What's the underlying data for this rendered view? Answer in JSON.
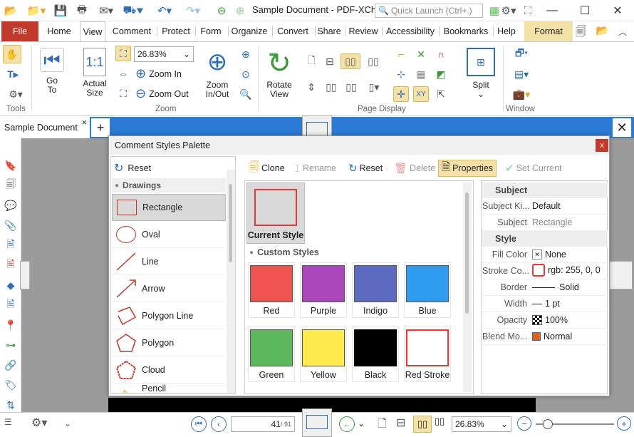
{
  "window": {
    "title": "Sample Document - PDF-XCha...",
    "quick_launch_placeholder": "Quick Launch (Ctrl+.)",
    "minimize": "—",
    "maximize": "☐",
    "close": "✕"
  },
  "ribbon_tabs": [
    "File",
    "Home",
    "View",
    "Comment",
    "Protect",
    "Form",
    "Organize",
    "Convert",
    "Share",
    "Review",
    "Accessibility",
    "Bookmarks",
    "Help",
    "Format"
  ],
  "ribbon": {
    "groups": {
      "tools": "Tools",
      "zoom": "Zoom",
      "page_display": "Page Display",
      "window": "Window"
    },
    "goto": "Go To",
    "actual_size": "Actual Size",
    "zoom_level": "26.83%",
    "zoom_in": "Zoom In",
    "zoom_out": "Zoom Out",
    "zoom_in_out": "Zoom In/Out",
    "rotate_view": "Rotate View",
    "split": "Split"
  },
  "document": {
    "tab_label": "Sample Document",
    "add_tab": "+",
    "close_tab": "×"
  },
  "dialog": {
    "title": "Comment Styles Palette",
    "close": "x",
    "left": {
      "reset": "Reset",
      "section": "Drawings",
      "items": [
        "Rectangle",
        "Oval",
        "Line",
        "Arrow",
        "Polygon Line",
        "Polygon",
        "Cloud",
        "Pencil"
      ]
    },
    "toolbar": {
      "clone": "Clone",
      "rename": "Rename",
      "reset": "Reset",
      "delete": "Delete",
      "properties": "Properties",
      "set_current": "Set Current"
    },
    "current_style": "Current Style",
    "custom_styles": "Custom Styles",
    "swatches": [
      {
        "name": "Red",
        "color": "#ef5350",
        "border": "#555"
      },
      {
        "name": "Purple",
        "color": "#ab47bc",
        "border": "#555"
      },
      {
        "name": "Indigo",
        "color": "#5c6bc0",
        "border": "#555"
      },
      {
        "name": "Blue",
        "color": "#2e9df0",
        "border": "#555"
      },
      {
        "name": "Green",
        "color": "#5cb85c",
        "border": "#555"
      },
      {
        "name": "Yellow",
        "color": "#ffe94d",
        "border": "#555"
      },
      {
        "name": "Black",
        "color": "#000000",
        "border": "#000"
      },
      {
        "name": "Red Stroke",
        "color": "#ffffff",
        "border": "#e53935"
      }
    ],
    "props": {
      "subject_head": "Subject",
      "subject_kind_label": "Subject Ki...",
      "subject_kind_value": "Default",
      "subject_label": "Subject",
      "subject_value": "Rectangle",
      "style_head": "Style",
      "fill_color_label": "Fill Color",
      "fill_color_value": "None",
      "stroke_label": "Stroke Co...",
      "stroke_value": "rgb: 255, 0, 0",
      "border_label": "Border",
      "border_value": "Solid",
      "width_label": "Width",
      "width_value": "1 pt",
      "opacity_label": "Opacity",
      "opacity_value": "100%",
      "blend_label": "Blend Mo...",
      "blend_value": "Normal"
    }
  },
  "status": {
    "page_current": "41",
    "page_total": "/ 91",
    "zoom": "26.83%"
  },
  "colors": {
    "accent": "#2b7bd4",
    "file_tab": "#c0392b",
    "highlight": "#f3e1a7"
  }
}
